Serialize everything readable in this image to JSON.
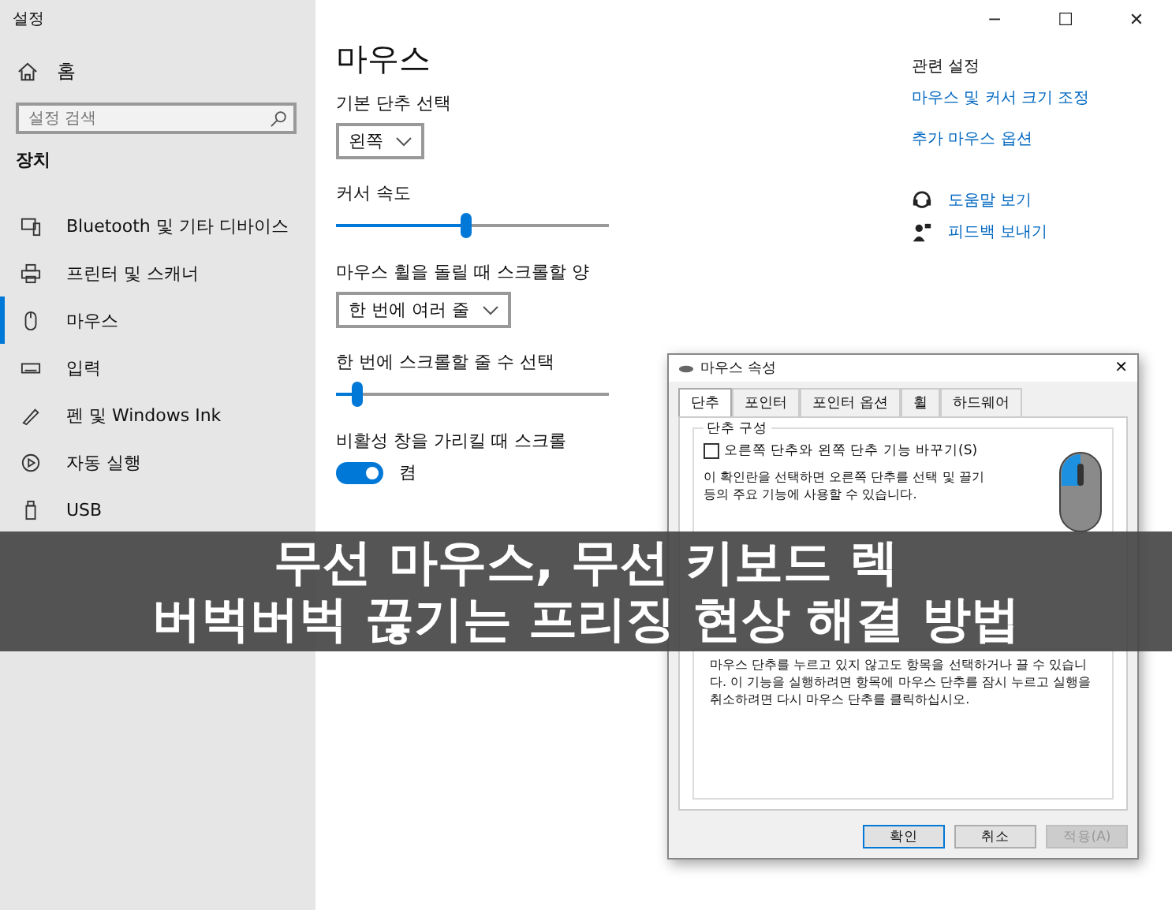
{
  "window": {
    "title": "설정",
    "controls": [
      "─",
      "☐",
      "✕"
    ]
  },
  "sidebar": {
    "home": "홈",
    "search": {
      "placeholder": "설정 검색"
    },
    "section": "장치",
    "items": [
      {
        "label": "Bluetooth 및 기타 디바이스",
        "selected": false
      },
      {
        "label": "프린터 및 스캐너",
        "selected": false
      },
      {
        "label": "마우스",
        "selected": true
      },
      {
        "label": "입력",
        "selected": false
      },
      {
        "label": "펜 및 Windows Ink",
        "selected": false
      },
      {
        "label": "자동 실행",
        "selected": false
      },
      {
        "label": "USB",
        "selected": false
      }
    ]
  },
  "main": {
    "title": "마우스",
    "settings": [
      {
        "kind": "dropdown",
        "label": "기본 단추 선택",
        "value": "왼쪽"
      },
      {
        "kind": "slider",
        "label": "커서 속도",
        "level": 0.48
      },
      {
        "kind": "dropdown",
        "label": "마우스 휠을 돌릴 때 스크롤할 양",
        "value": "한 번에 여러 줄"
      },
      {
        "kind": "slider",
        "label": "한 번에 스크롤할 줄 수 선택",
        "level": 0.08
      },
      {
        "kind": "toggle",
        "label": "비활성 창을 가리킬 때 스크롤",
        "on": true,
        "state": "켬"
      }
    ]
  },
  "related": {
    "title": "관련 설정",
    "links": [
      "마우스 및 커서 크기 조정",
      "추가 마우스 옵션"
    ],
    "help": [
      {
        "label": "도움말 보기"
      },
      {
        "label": "피드백 보내기"
      }
    ]
  },
  "dialog": {
    "title": "마우스 속성",
    "close": "✕",
    "tabs": [
      {
        "label": "단추",
        "selected": true
      },
      {
        "label": "포인터",
        "selected": false
      },
      {
        "label": "포인터 옵션",
        "selected": false
      },
      {
        "label": "휠",
        "selected": false
      },
      {
        "label": "하드웨어",
        "selected": false
      }
    ],
    "group": {
      "title": "단추 구성",
      "checkbox": {
        "label": "오른쪽 단추와 왼쪽 단추 기능 바꾸기(S)",
        "checked": false
      },
      "description": "이 확인란을 선택하면 오른쪽 단추를 선택 및 끌기 등의 주요 기능에 사용할 수 있습니다."
    },
    "click_lock_description": "마우스 단추를 누르고 있지 않고도 항목을 선택하거나 끌 수 있습니다. 이 기능을 실행하려면 항목에 마우스 단추를 잠시 누르고 실행을 취소하려면 다시 마우스 단추를 클릭하십시오.",
    "buttons": [
      {
        "label": "확인",
        "default": true,
        "disabled": false
      },
      {
        "label": "취소",
        "default": false,
        "disabled": false
      },
      {
        "label": "적용(A)",
        "default": false,
        "disabled": true
      }
    ]
  },
  "banner": {
    "lines": [
      "무선 마우스, 무선 키보드 렉",
      "버벅버벅 끊기는 프리징 현상 해결 방법"
    ]
  }
}
